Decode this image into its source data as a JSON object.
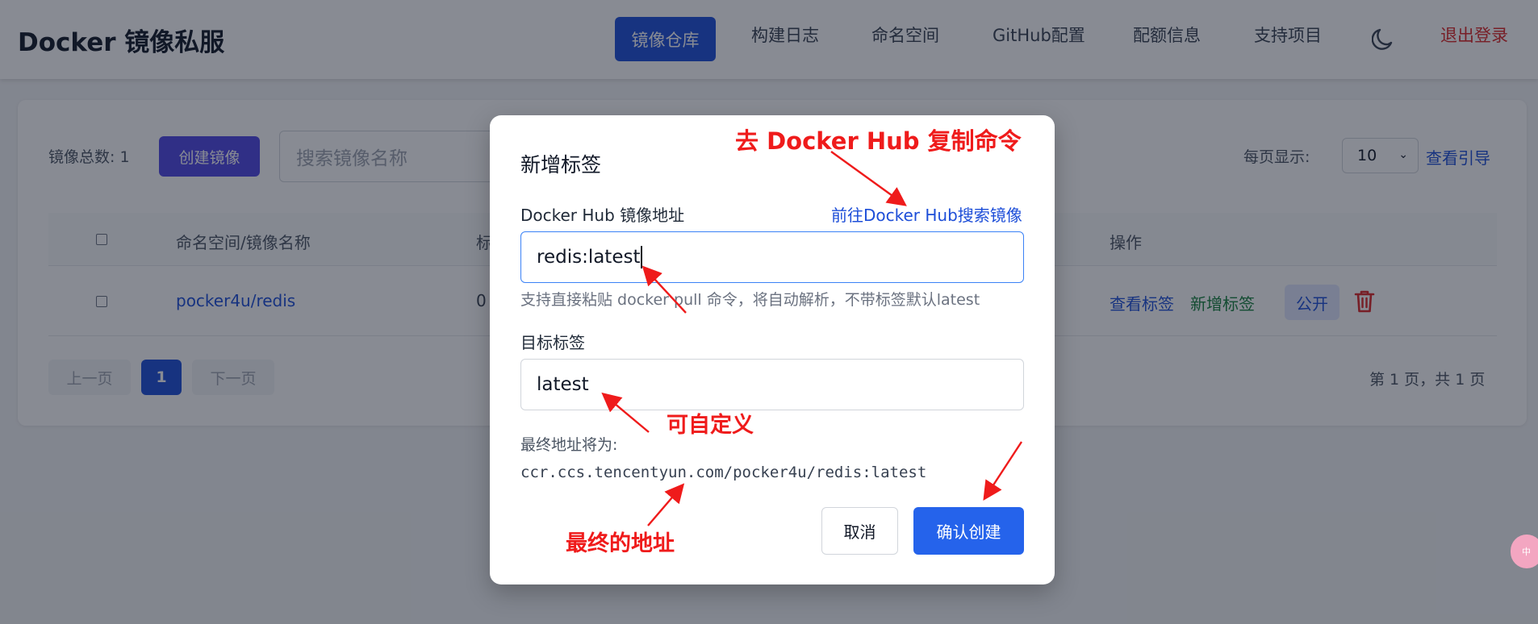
{
  "header": {
    "app_title": "Docker 镜像私服",
    "nav": {
      "repos": "镜像仓库",
      "build_logs": "构建日志",
      "namespaces": "命名空间",
      "github": "GitHub配置",
      "quota": "配额信息",
      "support": "支持项目"
    },
    "logout": "退出登录"
  },
  "toolbar": {
    "total": "镜像总数: 1",
    "create_image": "创建镜像",
    "search_placeholder": "搜索镜像名称",
    "per_page_label": "每页显示:",
    "per_page_value": "10",
    "guide": "查看引导"
  },
  "table": {
    "headers": {
      "name": "命名空间/镜像名称",
      "tags": "标签",
      "actions": "操作"
    },
    "rows": [
      {
        "name": "pocker4u/redis",
        "tags": "0",
        "view_tags": "查看标签",
        "add_tag": "新增标签",
        "visibility": "公开"
      }
    ]
  },
  "pagination": {
    "prev": "上一页",
    "current": "1",
    "next": "下一页",
    "info": "第 1 页，共 1 页"
  },
  "modal": {
    "title": "新增标签",
    "source_label": "Docker Hub 镜像地址",
    "source_link": "前往Docker Hub搜索镜像",
    "source_value": "redis:latest",
    "source_help": "支持直接粘贴 docker pull 命令，将自动解析，不带标签默认latest",
    "target_label": "目标标签",
    "target_value": "latest",
    "final_label": "最终地址将为:",
    "final_url": "ccr.ccs.tencentyun.com/pocker4u/redis:latest",
    "cancel": "取消",
    "confirm": "确认创建"
  },
  "annotations": {
    "copy_command": "去 Docker Hub 复制命令",
    "customizable": "可自定义",
    "final_address": "最终的地址"
  },
  "widget": {
    "text": "中"
  },
  "colors": {
    "primary": "#1d4ed8",
    "create_button": "#4f46e5",
    "danger": "#dc2626",
    "annotation": "#ef1b1b",
    "confirm_button": "#2563eb",
    "link_green": "#15803d"
  }
}
